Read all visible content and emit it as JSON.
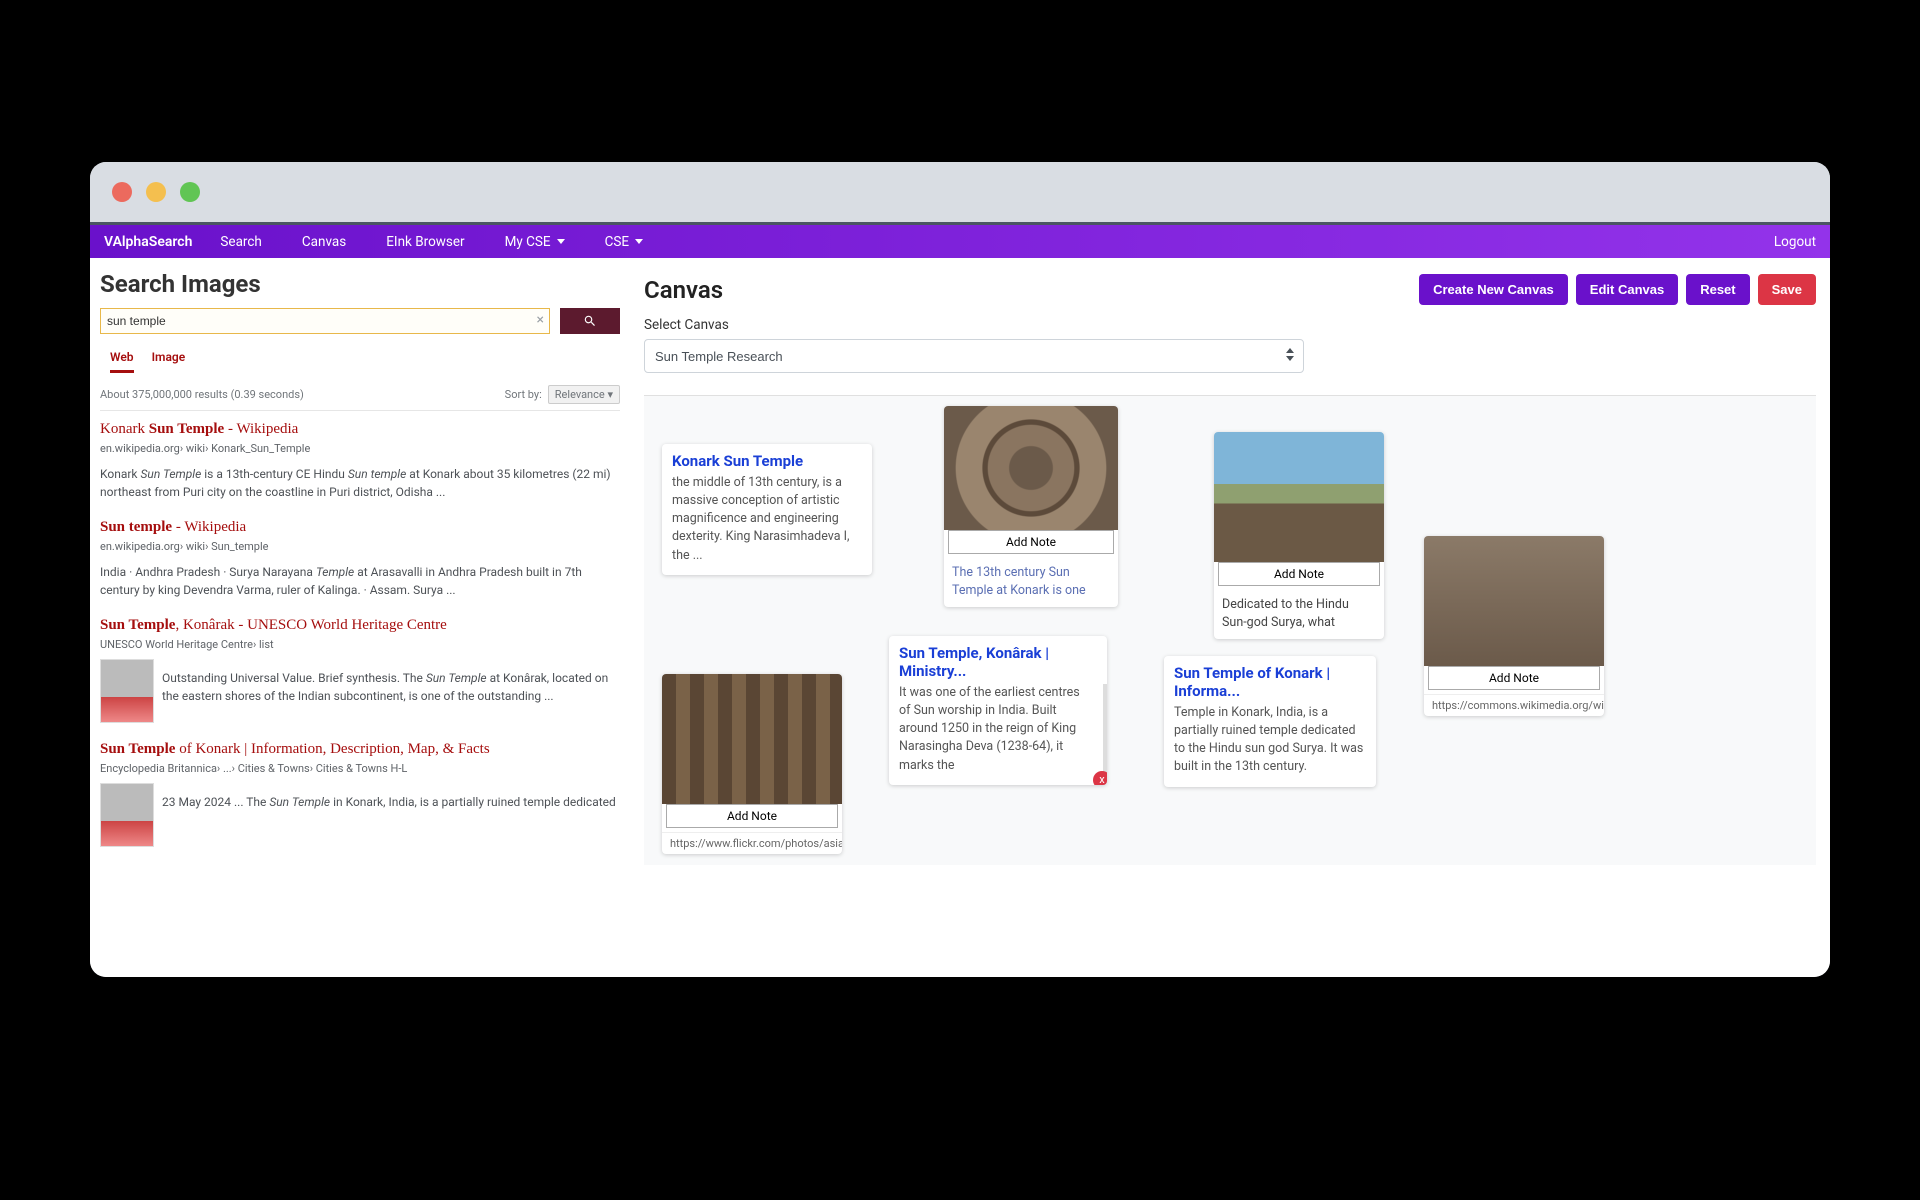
{
  "nav": {
    "brand": "VAlphaSearch",
    "links": [
      "Search",
      "Canvas",
      "EInk Browser"
    ],
    "dropdowns": [
      "My CSE",
      "CSE"
    ],
    "logout": "Logout"
  },
  "searchPanel": {
    "title": "Search Images",
    "query": "sun temple",
    "tabs": {
      "web": "Web",
      "image": "Image"
    },
    "stats": "About 375,000,000 results (0.39 seconds)",
    "sortLabel": "Sort by:",
    "sortValue": "Relevance"
  },
  "results": [
    {
      "titlePre": "Konark ",
      "titleBold": "Sun Temple",
      "titlePost": " - Wikipedia",
      "cite": "en.wikipedia.org› wiki› Konark_Sun_Temple",
      "snippet": "Konark <em>Sun Temple</em> is a 13th-century CE Hindu <em>Sun temple</em> at Konark about 35 kilometres (22 mi) northeast from Puri city on the coastline in Puri district, Odisha ..."
    },
    {
      "titlePre": "",
      "titleBold": "Sun temple",
      "titlePost": " - Wikipedia",
      "cite": "en.wikipedia.org› wiki› Sun_temple",
      "snippet": "India · Andhra Pradesh · Surya Narayana <em>Temple</em> at Arasavalli in Andhra Pradesh built in 7th century by king Devendra Varma, ruler of Kalinga. · Assam. Surya ..."
    },
    {
      "titlePre": "",
      "titleBold": "Sun Temple",
      "titlePost": ", Konârak - UNESCO World Heritage Centre",
      "cite": "UNESCO World Heritage Centre› list",
      "thumb": true,
      "snippet": "Outstanding Universal Value. Brief synthesis. The <em>Sun Temple</em> at Konârak, located on the eastern shores of the Indian subcontinent, is one of the outstanding ..."
    },
    {
      "titlePre": "",
      "titleBold": "Sun Temple",
      "titlePost": " of Konark | Information, Description, Map, & Facts",
      "cite": "Encyclopedia Britannica› ...› Cities & Towns› Cities & Towns H-L",
      "thumb": true,
      "snippet": "23 May 2024 ... The <em>Sun Temple</em> in Konark, India, is a partially ruined temple dedicated"
    }
  ],
  "canvas": {
    "title": "Canvas",
    "btns": {
      "create": "Create New Canvas",
      "edit": "Edit Canvas",
      "reset": "Reset",
      "save": "Save"
    },
    "selectLabel": "Select Canvas",
    "selectValue": "Sun Temple Research",
    "addNote": "Add Note",
    "closeX": "x",
    "cards": {
      "c1": {
        "title": "Konark Sun Temple",
        "body": "the middle of 13th century, is a massive conception of artistic magnificence and engineering dexterity. King Narasimhadeva I, the ..."
      },
      "c2": {
        "caption": "The 13th century Sun Temple at Konark is one"
      },
      "c3": {
        "caption": "Dedicated to the Hindu Sun-god Surya, what"
      },
      "c4": {
        "title": "Sun Temple, Konârak | Ministry...",
        "body": "It was one of the earliest centres of Sun worship in India. Built around 1250 in the reign of King Narasingha Deva (1238-64), it marks the"
      },
      "c5": {
        "title": "Sun Temple of Konark | Informa...",
        "body": "Temple in Konark, India, is a partially ruined temple dedicated to the Hindu sun god Surya. It was built in the 13th century."
      },
      "c6": {
        "url": "https://commons.wikimedia.org/wil"
      },
      "c7": {
        "url": "https://www.flickr.com/photos/asia"
      }
    }
  }
}
